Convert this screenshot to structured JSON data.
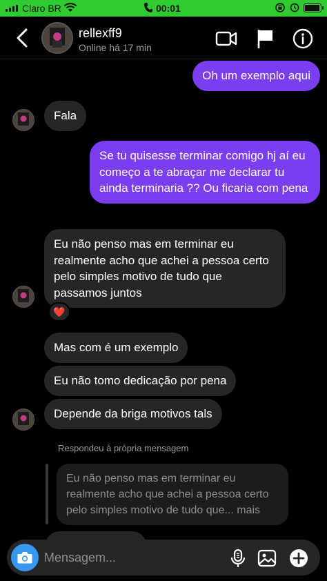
{
  "status_bar": {
    "carrier": "Claro BR",
    "time": "00:01",
    "battery_level": 0.95
  },
  "header": {
    "username": "rellexff9",
    "presence": "Online há 17 min",
    "icons": [
      "back-icon",
      "video-call-icon",
      "flag-icon",
      "info-icon"
    ]
  },
  "messages": [
    {
      "from": "me",
      "text": "Oh um exemplo aqui"
    },
    {
      "from": "them",
      "text": "Fala"
    },
    {
      "from": "me",
      "text": "Se tu quisesse terminar comigo hj aí eu começo a te abraçar me declarar tu ainda terminaria ?? Ou ficaria com pena"
    },
    {
      "from": "them",
      "text": "Eu não penso mas em terminar eu realmente acho que achei a pessoa certo pelo simples motivo de tudo que passamos juntos",
      "reaction": "❤️"
    },
    {
      "from": "them",
      "text": "Mas com é um exemplo"
    },
    {
      "from": "them",
      "text": "Eu não tomo dedicação por pena"
    },
    {
      "from": "them",
      "text": "Depende da briga motivos tals"
    }
  ],
  "reply": {
    "note": "Respondeu à própria mensagem",
    "quoted_text": "Eu não penso mas em terminar eu realmente acho que achei a pessoa certo pelo simples motivo de tudo que... mais"
  },
  "composer": {
    "placeholder": "Mensagem...",
    "icons": [
      "camera-icon",
      "microphone-icon",
      "gallery-icon",
      "add-icon"
    ]
  },
  "colors": {
    "outgoing_bubble": "#7b3df0",
    "incoming_bubble": "#262626",
    "status_bar": "#2ecc2e",
    "camera_button": "#3897f0"
  }
}
